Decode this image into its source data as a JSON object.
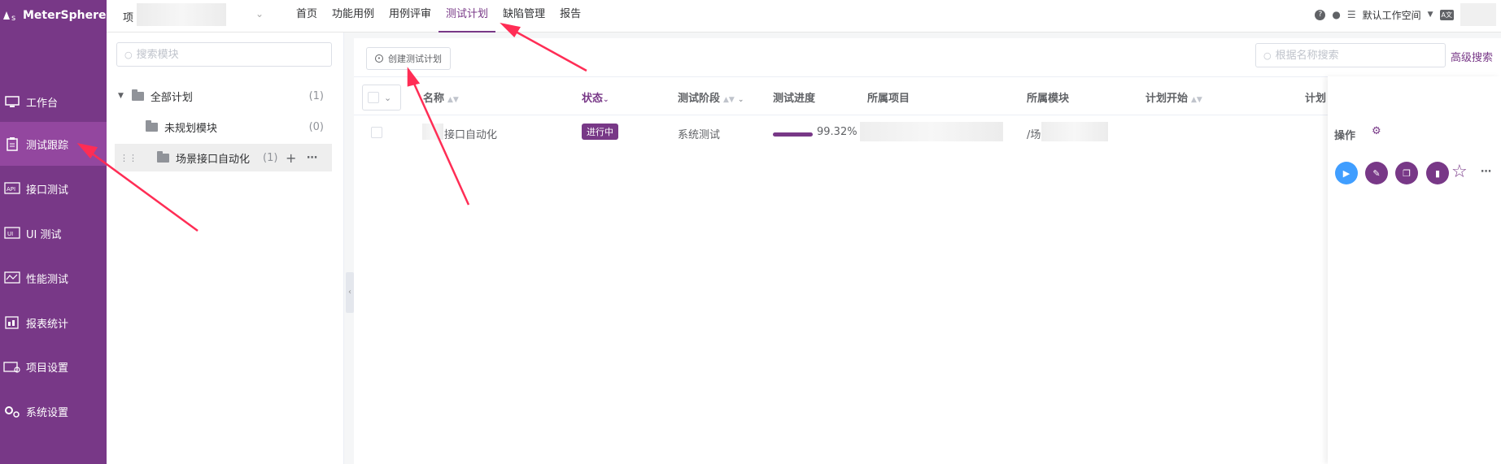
{
  "app": {
    "brand": "MeterSphere"
  },
  "sidebar": {
    "items": [
      {
        "label": "工作台",
        "icon": "monitor-icon"
      },
      {
        "label": "测试跟踪",
        "icon": "clipboard-icon"
      },
      {
        "label": "接口测试",
        "icon": "api-icon"
      },
      {
        "label": "UI 测试",
        "icon": "ui-icon"
      },
      {
        "label": "性能测试",
        "icon": "chart-icon"
      },
      {
        "label": "报表统计",
        "icon": "report-icon"
      },
      {
        "label": "项目设置",
        "icon": "project-icon"
      },
      {
        "label": "系统设置",
        "icon": "gear-icon"
      }
    ],
    "active_index": 1
  },
  "header": {
    "project_label": "项",
    "menu": [
      "首页",
      "功能用例",
      "用例评审",
      "测试计划",
      "缺陷管理",
      "报告"
    ],
    "active_menu": "测试计划",
    "workspace": "默认工作空间"
  },
  "module": {
    "search_placeholder": "搜索模块",
    "tree": [
      {
        "label": "全部计划",
        "count": "(1)"
      },
      {
        "label": "未规划模块",
        "count": "(0)"
      },
      {
        "label": "场景接口自动化",
        "count": "(1)"
      }
    ]
  },
  "main": {
    "create_button": "创建测试计划",
    "search_placeholder": "根据名称搜索",
    "advanced_search": "高级搜索",
    "columns": {
      "name": "名称",
      "status": "状态",
      "stage": "测试阶段",
      "progress": "测试进度",
      "project": "所属项目",
      "module": "所属模块",
      "plan_start": "计划开始",
      "plan_end": "计划",
      "ops": "操作"
    },
    "row": {
      "name": "接口自动化",
      "status": "进行中",
      "stage": "系统测试",
      "progress_text": "99.32%",
      "progress": 0.9932,
      "module_prefix": "/场"
    }
  },
  "colors": {
    "brand": "#783887",
    "play": "#409eff"
  }
}
